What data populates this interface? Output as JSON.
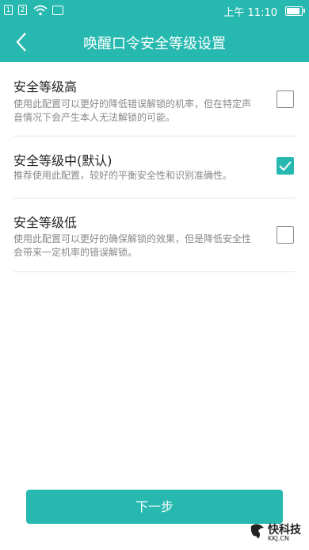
{
  "status_bar": {
    "sim1": "1",
    "sim2": "2",
    "time": "上午 11:10"
  },
  "header": {
    "title": "唤醒口令安全等级设置"
  },
  "options": [
    {
      "title": "安全等级高",
      "description": "使用此配置可以更好的降低错误解锁的机率，但在特定声音情况下会产生本人无法解锁的可能。",
      "checked": false
    },
    {
      "title": "安全等级中(默认)",
      "description": "推荐使用此配置，较好的平衡安全性和识别准确性。",
      "checked": true
    },
    {
      "title": "安全等级低",
      "description": "使用此配置可以更好的确保解锁的效果，但是降低安全性会带来一定机率的错误解锁。",
      "checked": false
    }
  ],
  "next_button": {
    "label": "下一步"
  },
  "watermark": {
    "text": "快科技",
    "subtext": "KKJ.CN"
  },
  "colors": {
    "accent": "#27b9b0"
  }
}
